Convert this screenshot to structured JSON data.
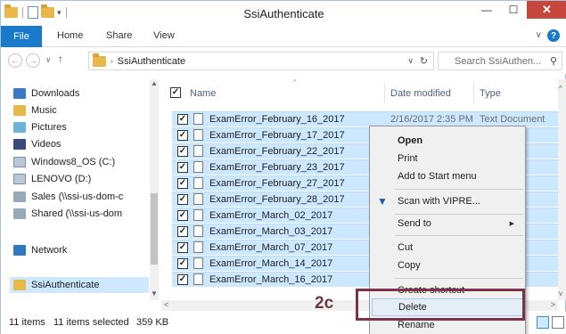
{
  "window": {
    "title": "SsiAuthenticate"
  },
  "ribbon": {
    "file": "File",
    "home": "Home",
    "share": "Share",
    "view": "View",
    "help": "?"
  },
  "address": {
    "crumbs": [
      "SsiAuthenticate"
    ],
    "search_placeholder": "Search SsiAuthen..."
  },
  "nav": {
    "items": [
      {
        "label": "Downloads",
        "icon": "downloads-icon"
      },
      {
        "label": "Music",
        "icon": "music-folder-icon"
      },
      {
        "label": "Pictures",
        "icon": "pictures-folder-icon"
      },
      {
        "label": "Videos",
        "icon": "videos-folder-icon"
      },
      {
        "label": "Windows8_OS (C:)",
        "icon": "drive-icon"
      },
      {
        "label": "LENOVO (D:)",
        "icon": "drive-icon"
      },
      {
        "label": "Sales (\\\\ssi-us-dom-c",
        "icon": "network-drive-icon"
      },
      {
        "label": "Shared (\\\\ssi-us-dom",
        "icon": "network-drive-icon"
      },
      {
        "label": "Network",
        "icon": "network-icon"
      },
      {
        "label": "SsiAuthenticate",
        "icon": "folder-icon"
      }
    ]
  },
  "columns": {
    "name": "Name",
    "date": "Date modified",
    "type": "Type"
  },
  "files": [
    {
      "name": "ExamError_February_16_2017",
      "date": "2/16/2017 2:35 PM",
      "type": "Text Document"
    },
    {
      "name": "ExamError_February_17_2017",
      "date": "",
      "type": "cument"
    },
    {
      "name": "ExamError_February_22_2017",
      "date": "",
      "type": "cument"
    },
    {
      "name": "ExamError_February_23_2017",
      "date": "",
      "type": "cument"
    },
    {
      "name": "ExamError_February_27_2017",
      "date": "",
      "type": "cument"
    },
    {
      "name": "ExamError_February_28_2017",
      "date": "",
      "type": "cument"
    },
    {
      "name": "ExamError_March_02_2017",
      "date": "",
      "type": "cument"
    },
    {
      "name": "ExamError_March_03_2017",
      "date": "",
      "type": "cument"
    },
    {
      "name": "ExamError_March_07_2017",
      "date": "",
      "type": "cument"
    },
    {
      "name": "ExamError_March_14_2017",
      "date": "",
      "type": "cument"
    },
    {
      "name": "ExamError_March_16_2017",
      "date": "",
      "type": "cument"
    }
  ],
  "context_menu": {
    "open": "Open",
    "print": "Print",
    "add_to_start": "Add to Start menu",
    "scan": "Scan with VIPRE...",
    "send_to": "Send to",
    "cut": "Cut",
    "copy": "Copy",
    "create_shortcut": "Create shortcut",
    "delete": "Delete",
    "rename": "Rename"
  },
  "status": {
    "items": "11 items",
    "selected": "11 items selected",
    "size": "359 KB"
  },
  "annotation": {
    "label": "2c",
    "color": "#7b3347"
  }
}
